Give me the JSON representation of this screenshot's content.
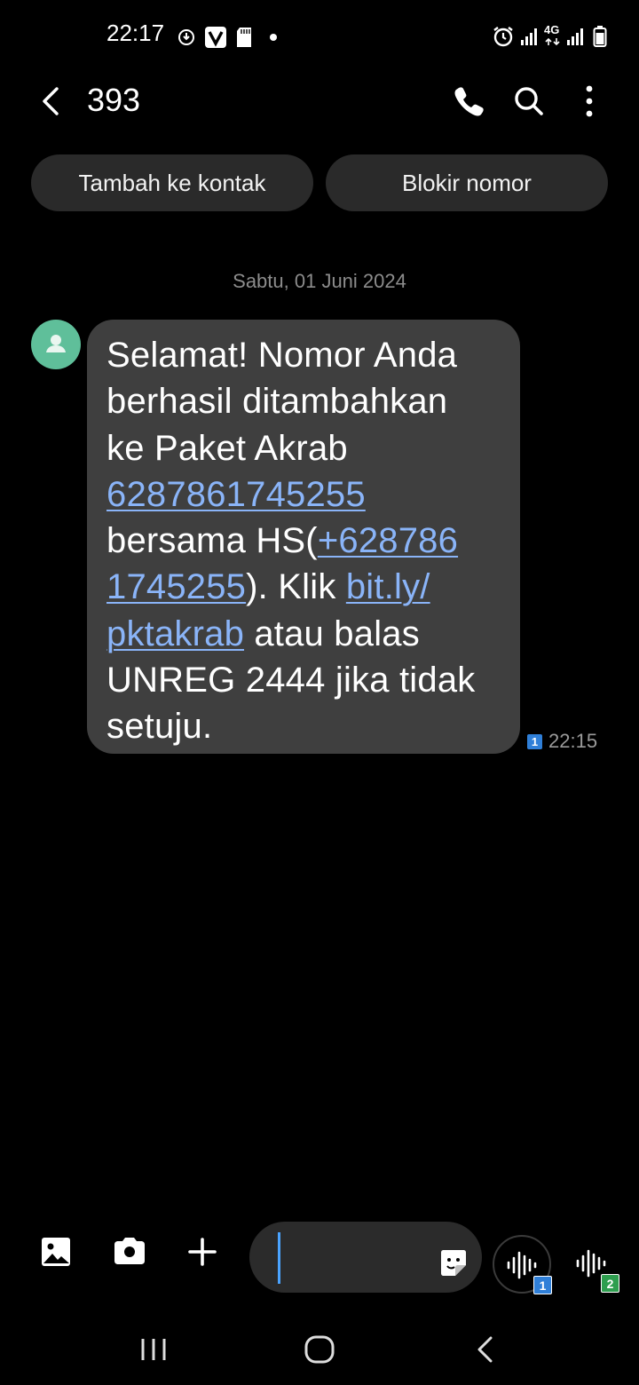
{
  "status_bar": {
    "time": "22:17",
    "left_icons": [
      "download-icon",
      "v-app-icon",
      "sd-card-icon",
      "dot-icon"
    ],
    "right_icons": [
      "alarm-icon",
      "signal-icon",
      "4g-icon",
      "signal-icon",
      "battery-icon"
    ],
    "network_label": "4G"
  },
  "header": {
    "title": "393",
    "icons": [
      "back-icon",
      "phone-icon",
      "search-icon",
      "more-icon"
    ]
  },
  "actions": {
    "add_contact": "Tambah ke kontak",
    "block_number": "Blokir nomor"
  },
  "conversation": {
    "date": "Sabtu, 01 Juni 2024",
    "message": {
      "text": "Selamat! Nomor Anda berhasil ditambahkan ke Paket Akrab 6287861745255 bersama HS(+6287861745255). Klik bit.ly/pktakrab atau balas UNREG 2444 jika tidak setuju.",
      "lines": [
        "Selamat! Nomor Anda",
        "berhasil ditambahkan",
        "ke Paket Akrab",
        "6287861745255",
        "bersama HS(",
        "+628786",
        "1745255",
        "). Klik ",
        "bit.ly/",
        "pktakrab",
        " atau balas",
        "UNREG 2444 jika tidak",
        "setuju."
      ],
      "sim": "1",
      "time": "22:15"
    }
  },
  "compose": {
    "icons": [
      "gallery-icon",
      "camera-icon",
      "plus-icon",
      "sticker-icon"
    ],
    "input_value": "",
    "voice_sim_1": "1",
    "voice_sim_2": "2"
  },
  "nav_bar": {
    "icons": [
      "recents-icon",
      "home-icon",
      "back-nav-icon"
    ]
  },
  "colors": {
    "background": "#000000",
    "bubble": "#3f3f3f",
    "link": "#8ab4f8",
    "avatar": "#5fbf9a",
    "cursor": "#4aa3ff",
    "sim1_badge": "#2f7fd8",
    "sim2_badge": "#2e9e4f"
  }
}
